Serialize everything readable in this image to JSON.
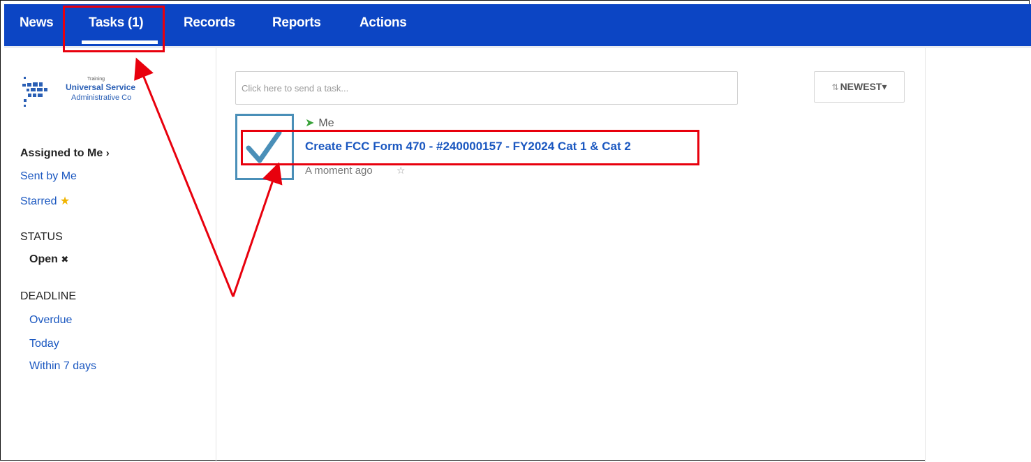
{
  "nav": {
    "items": [
      {
        "label": "News"
      },
      {
        "label": "Tasks (1)"
      },
      {
        "label": "Records"
      },
      {
        "label": "Reports"
      },
      {
        "label": "Actions"
      }
    ]
  },
  "logo": {
    "training": "Training",
    "line1": "Universal Service",
    "line2": "Administrative Co"
  },
  "sidebar": {
    "assigned": "Assigned to Me",
    "assigned_icon": "chevron-right-icon",
    "sent": "Sent by Me",
    "starred": "Starred",
    "starred_icon": "star-icon",
    "status_heading": "STATUS",
    "status_value": "Open",
    "status_clear_icon": "x-icon",
    "deadline_heading": "DEADLINE",
    "deadline_options": [
      "Overdue",
      "Today",
      "Within 7 days"
    ]
  },
  "main": {
    "task_input_placeholder": "Click here to send a task...",
    "sort_label": "NEWEST",
    "task": {
      "assignee": "Me",
      "title": "Create FCC Form 470 - #240000157 - FY2024 Cat 1 & Cat 2",
      "time": "A moment ago",
      "check_icon": "checkmark-icon",
      "star_icon": "star-outline-icon"
    }
  },
  "colors": {
    "nav_bg": "#0c45c4",
    "link": "#1a57c0",
    "checkbox_border": "#4a8fb8",
    "annotation": "#e8000d"
  }
}
